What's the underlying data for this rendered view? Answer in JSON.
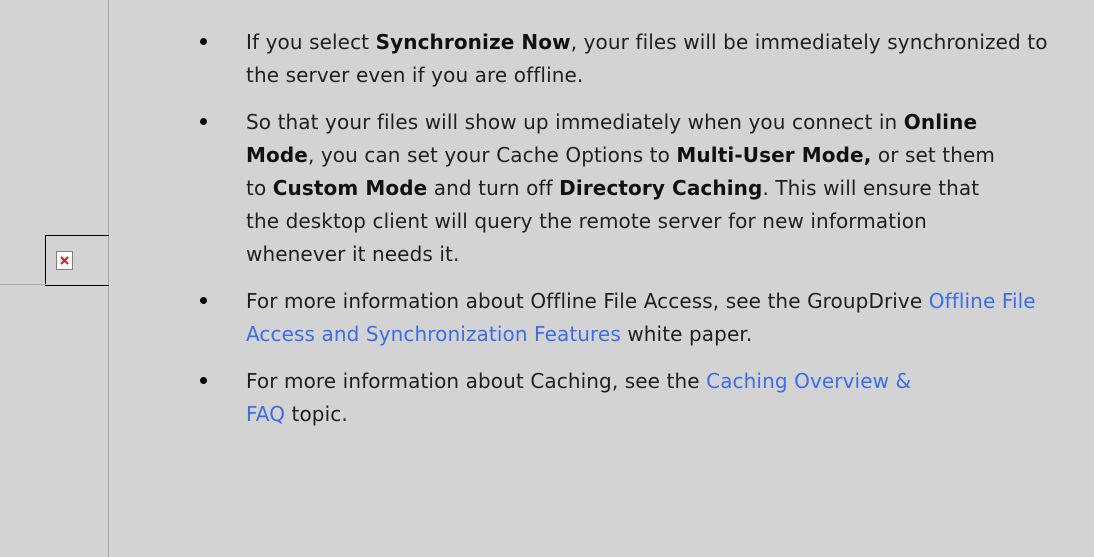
{
  "image_placeholder": {
    "icon": "broken-image-icon",
    "icon_color": "#e02020"
  },
  "bullets": [
    {
      "t1": "If you select ",
      "b1": "Synchronize Now",
      "t2": ", your files will be immediately synchronized to the server even if you are offline."
    },
    {
      "t1": "So that your files will show up immediately when you connect in ",
      "b1": "Online Mode",
      "t2": ", you can set your Cache Options to ",
      "b2": "Multi-User Mode,",
      "t3": " or set them to ",
      "b3": "Custom Mode",
      "t4": " and turn off ",
      "b4": "Directory Caching",
      "t5": ". This will ensure that the desktop client will query the remote server for new information whenever it needs it."
    },
    {
      "t1": "For more information about Offline File Access, see the GroupDrive ",
      "link": "Offline File Access and Synchronization Features",
      "t2": " white paper."
    },
    {
      "t1": "For more information about Caching, see the ",
      "link": "Caching Overview & FAQ",
      "t2": " topic."
    }
  ],
  "colors": {
    "background": "#d3d3d3",
    "link": "#3b6ee8",
    "text": "#1f1f1f"
  }
}
